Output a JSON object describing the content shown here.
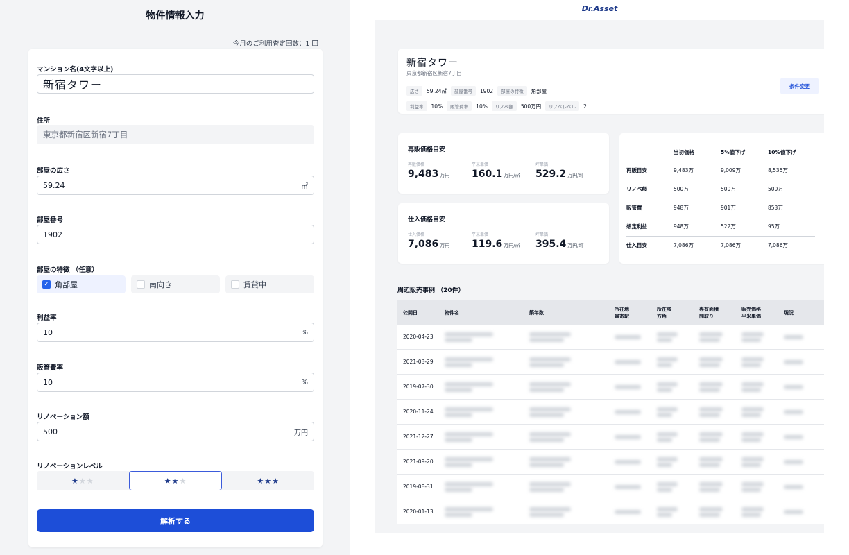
{
  "form": {
    "title": "物件情報入力",
    "usage": "今月のご利用査定回数：1 回",
    "mansion_label": "マンション名(4文字以上)",
    "mansion_value": "新宿タワー",
    "address_label": "住所",
    "address_value": "東京都新宿区新宿7丁目",
    "area_label": "部屋の広さ",
    "area_value": "59.24",
    "area_unit": "㎡",
    "room_label": "部屋番号",
    "room_value": "1902",
    "features_label": "部屋の特徴 （任意）",
    "features": [
      {
        "label": "角部屋",
        "checked": true
      },
      {
        "label": "南向き",
        "checked": false
      },
      {
        "label": "賃貸中",
        "checked": false
      }
    ],
    "profit_label": "利益率",
    "profit_value": "10",
    "profit_unit": "%",
    "sga_label": "販管費率",
    "sga_value": "10",
    "sga_unit": "%",
    "renov_label": "リノベーション額",
    "renov_value": "500",
    "renov_unit": "万円",
    "level_label": "リノベーションレベル",
    "levels": [
      {
        "on": "★",
        "off": "★★",
        "selected": false
      },
      {
        "on": "★★",
        "off": "★",
        "selected": true
      },
      {
        "on": "★★★",
        "off": "",
        "selected": false
      }
    ],
    "submit_label": "解析する"
  },
  "result": {
    "brand": "Dr.Asset",
    "property": {
      "name": "新宿タワー",
      "address": "東京都新宿区新宿7丁目",
      "tags_row1": [
        {
          "tag": "広さ",
          "value": "59.24㎡"
        },
        {
          "tag": "部屋番号",
          "value": "1902"
        },
        {
          "tag": "部屋の特徴",
          "value": "角部屋"
        }
      ],
      "tags_row2": [
        {
          "tag": "利益率",
          "value": "10%"
        },
        {
          "tag": "販管費率",
          "value": "10%"
        },
        {
          "tag": "リノベ額",
          "value": "500万円"
        },
        {
          "tag": "リノベレベル",
          "value": "2"
        }
      ],
      "change_button": "条件変更"
    },
    "resale": {
      "title": "再販価格目安",
      "metrics": [
        {
          "label": "再販価格",
          "value": "9,483",
          "unit": "万円"
        },
        {
          "label": "平米単価",
          "value": "160.1",
          "unit": "万円/㎡"
        },
        {
          "label": "坪単価",
          "value": "529.2",
          "unit": "万円/坪"
        }
      ]
    },
    "purchase": {
      "title": "仕入価格目安",
      "metrics": [
        {
          "label": "仕入価格",
          "value": "7,086",
          "unit": "万円"
        },
        {
          "label": "平米単価",
          "value": "119.6",
          "unit": "万円/㎡"
        },
        {
          "label": "坪単価",
          "value": "395.4",
          "unit": "万円/坪"
        }
      ]
    },
    "summary": {
      "headers": [
        "",
        "当初価格",
        "5%値下げ",
        "10%値下げ"
      ],
      "rows": [
        [
          "再販目安",
          "9,483万",
          "9,009万",
          "8,535万"
        ],
        [
          "リノベ額",
          "500万",
          "500万",
          "500万"
        ],
        [
          "販管費",
          "948万",
          "901万",
          "853万"
        ],
        [
          "想定利益",
          "948万",
          "522万",
          "95万"
        ],
        [
          "仕入目安",
          "7,086万",
          "7,086万",
          "7,086万"
        ]
      ]
    },
    "listings": {
      "title": "周辺販売事例 （20件）",
      "headers": [
        [
          "公開日"
        ],
        [
          "物件名"
        ],
        [
          "築年数"
        ],
        [
          "所在地",
          "最寄駅"
        ],
        [
          "所在階",
          "方角"
        ],
        [
          "専有面積",
          "間取り"
        ],
        [
          "販売価格",
          "平米単価"
        ],
        [
          "現況"
        ]
      ],
      "dates": [
        "2020-04-23",
        "2021-03-29",
        "2019-07-30",
        "2020-11-24",
        "2021-12-27",
        "2021-09-20",
        "2019-08-31",
        "2020-01-13"
      ]
    }
  }
}
